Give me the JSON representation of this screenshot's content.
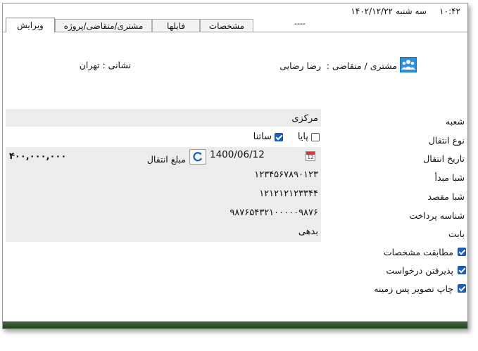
{
  "header": {
    "time": "۱۰:۴۲",
    "weekday": "سه شنبه",
    "date": "۱۴۰۲/۱۲/۲۲",
    "placeholder": "----"
  },
  "tabs": [
    {
      "label": "ویرایش",
      "active": true
    },
    {
      "label": "مشتری/متقاضی/پروژه",
      "active": false
    },
    {
      "label": "فایلها",
      "active": false
    },
    {
      "label": "مشخصات",
      "active": false
    }
  ],
  "customer": {
    "label": "مشتری / متقاضی :",
    "name": "رضا رضایی",
    "address": "نشانی : تهران"
  },
  "form": {
    "branch_label": "شعبه",
    "branch_value": "مرکزی",
    "transfer_type_label": "نوع انتقال",
    "transfer_options": [
      {
        "label": "پایا",
        "checked": false
      },
      {
        "label": "ساتنا",
        "checked": true
      }
    ],
    "transfer_date_label": "تاریخ انتقال",
    "transfer_date_value": "1400/06/12",
    "amount_label": "مبلغ انتقال",
    "amount_value": "۴۰۰,۰۰۰,۰۰۰",
    "source_sheba_label": "شبا مبدأ",
    "source_sheba_value": "۱۲۳۴۵۶۷۸۹۰۱۲۳",
    "dest_sheba_label": "شبا مقصد",
    "dest_sheba_value": "۱۲۱۲۱۲۱۲۳۳۴۴",
    "payment_id_label": "شناسه پرداخت",
    "payment_id_value": "۹۸۷۶۵۴۳۲۱۰۰۰۰۰۹۸۷۶",
    "reason_label": "بابت",
    "reason_value": "بدهی"
  },
  "checkboxes": [
    {
      "label": "مطابقت مشخصات",
      "checked": true
    },
    {
      "label": "پذیرفتن درخواست",
      "checked": true
    },
    {
      "label": "چاپ تصویر پس زمینه",
      "checked": true
    }
  ],
  "icons": {
    "customer": "customer-group-icon",
    "calendar": "calendar-icon",
    "refresh": "refresh-icon"
  },
  "colors": {
    "accent": "#1a5fc1",
    "field_background": "#ececec",
    "icon_blue": "#2f8fd8"
  }
}
